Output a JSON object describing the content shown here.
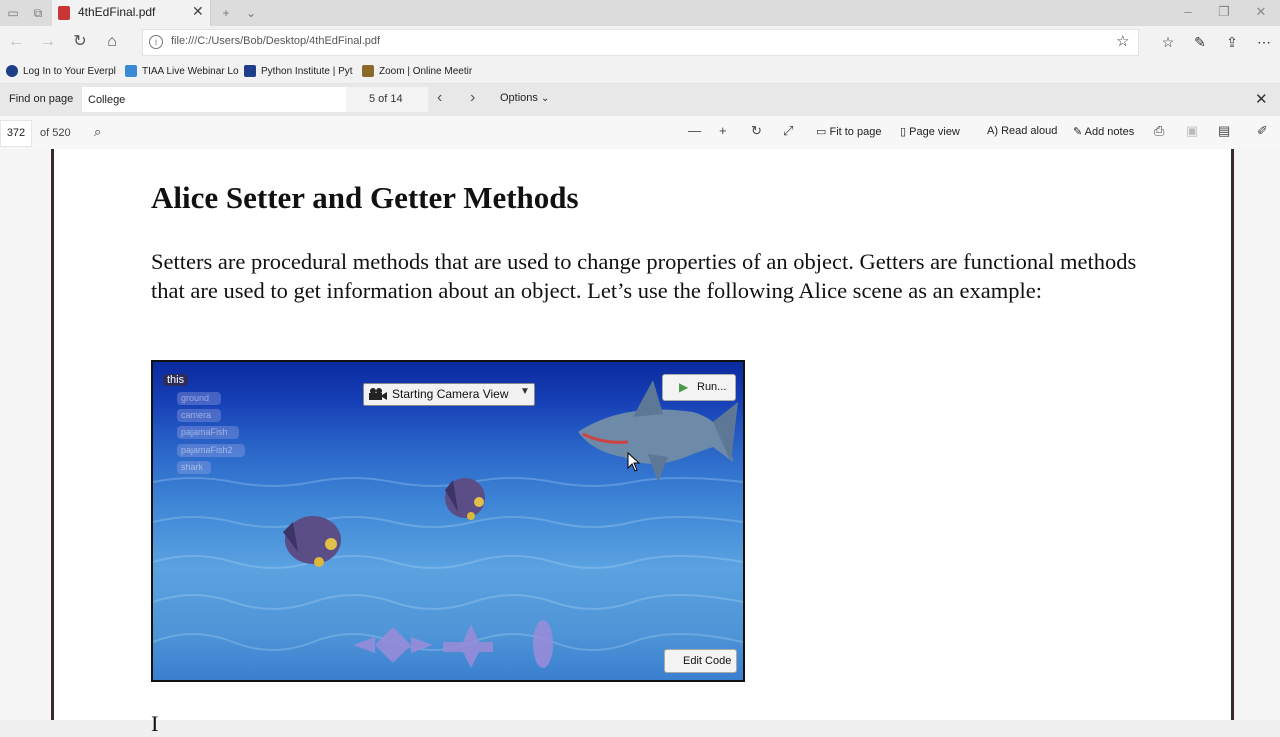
{
  "browser": {
    "tab_title": "4thEdFinal.pdf",
    "address": "file:///C:/Users/Bob/Desktop/4thEdFinal.pdf",
    "favorites": [
      {
        "label": "Log In to Your Everpl",
        "icon": "everplans-icon",
        "color": "#1d3f86"
      },
      {
        "label": "TIAA Live Webinar Lo",
        "icon": "tiaa-icon",
        "color": "#3a8ad8"
      },
      {
        "label": "Python Institute | Pyt",
        "icon": "python-institute-icon",
        "color": "#1f3e8c"
      },
      {
        "label": "Zoom | Online Meetir",
        "icon": "zoom-icon",
        "color": "#8a6a2c"
      }
    ]
  },
  "find": {
    "label": "Find on page",
    "query": "College",
    "count": "5 of 14",
    "options_label": "Options"
  },
  "pdf_toolbar": {
    "page": "372",
    "total": "of 520",
    "fit_to_page": "Fit to page",
    "page_view": "Page view",
    "read_aloud": "Read aloud",
    "add_notes": "Add notes"
  },
  "document": {
    "heading": "Alice Setter and Getter Methods",
    "paragraph": "Setters are procedural methods that are used to change properties of an object. Getters are functional methods that are used to get information about an object. Let’s use the following Alice scene as an example:",
    "next_line": "I"
  },
  "alice_scene": {
    "this_label": "this",
    "objects": [
      "ground",
      "camera",
      "pajamaFish",
      "pajamaFish2",
      "shark"
    ],
    "camera_view": "Starting Camera View",
    "run_label": "Run...",
    "edit_code_label": "Edit Code"
  }
}
